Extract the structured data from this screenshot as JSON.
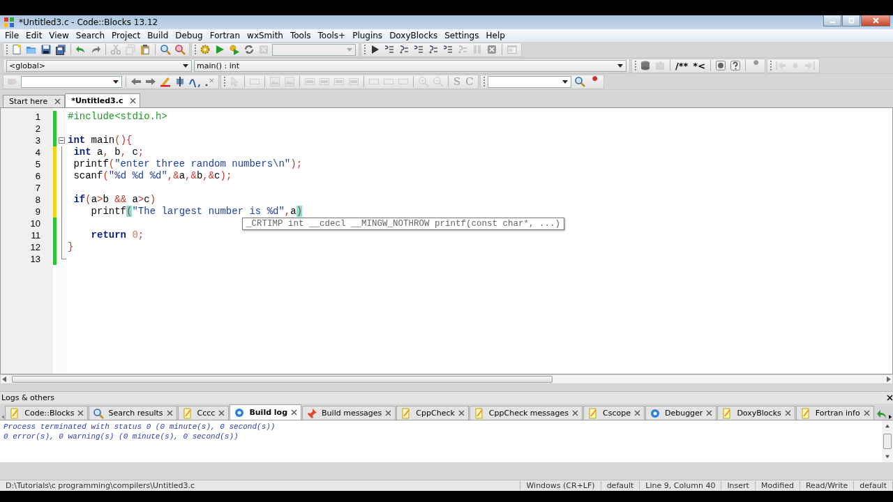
{
  "window": {
    "title": "*Untitled3.c - Code::Blocks 13.12"
  },
  "menu": [
    "File",
    "Edit",
    "View",
    "Search",
    "Project",
    "Build",
    "Debug",
    "Fortran",
    "wxSmith",
    "Tools",
    "Tools+",
    "Plugins",
    "DoxyBlocks",
    "Settings",
    "Help"
  ],
  "main_toolbar": [
    {
      "disabled": false
    },
    {
      "disabled": false
    },
    {
      "disabled": false
    },
    {
      "disabled": false
    },
    {
      "disabled": false
    },
    {
      "disabled": false
    },
    {
      "disabled": true
    },
    {
      "disabled": true
    },
    {
      "disabled": false
    },
    {
      "disabled": false
    },
    {
      "disabled": false
    },
    {
      "disabled": false
    },
    {
      "disabled": false
    },
    {
      "disabled": false
    },
    {
      "disabled": false
    },
    {
      "disabled": true
    },
    {
      "disabled": false
    },
    {
      "disabled": false
    },
    {
      "disabled": false
    },
    {
      "disabled": false
    },
    {
      "disabled": false
    },
    {
      "disabled": false
    },
    {
      "disabled": true
    },
    {
      "disabled": true
    },
    {
      "disabled": false
    },
    {
      "disabled": true
    }
  ],
  "code_completion": {
    "scope": "<global>",
    "function": "main() : int"
  },
  "doxyblocks_buttons": [
    "/**",
    "*<"
  ],
  "search_toolbar_buttons": [
    "S",
    "C"
  ],
  "editor_tabs": [
    {
      "label": "Start here",
      "selected": false
    },
    {
      "label": "*Untitled3.c",
      "selected": true
    }
  ],
  "code": [
    {
      "number": "1",
      "modified": false,
      "tokens": [
        {
          "t": "#include<stdio.h>",
          "kind": "preprocessor"
        }
      ]
    },
    {
      "number": "2",
      "modified": false
    },
    {
      "number": "3",
      "modified": false,
      "expanded": true,
      "tokens": [
        {
          "t": "int",
          "kind": "keyword"
        },
        {
          "t": " main",
          "kind": "identifier"
        },
        {
          "t": "(){",
          "kind": "operator"
        }
      ]
    },
    {
      "number": "4",
      "modified": true,
      "tokens": [
        {
          "t": " int",
          "kind": "keyword"
        },
        {
          "t": " a",
          "kind": "identifier"
        },
        {
          "t": ",",
          "kind": "operator"
        },
        {
          "t": " b",
          "kind": "identifier"
        },
        {
          "t": ",",
          "kind": "operator"
        },
        {
          "t": " c",
          "kind": "identifier"
        },
        {
          "t": ";",
          "kind": "operator"
        }
      ]
    },
    {
      "number": "5",
      "modified": true,
      "tokens": [
        {
          "t": " printf",
          "kind": "identifier"
        },
        {
          "t": "(",
          "kind": "operator"
        },
        {
          "t": "\"enter three random numbers\\n\"",
          "kind": "string"
        },
        {
          "t": ");",
          "kind": "operator"
        }
      ]
    },
    {
      "number": "6",
      "modified": true,
      "tokens": [
        {
          "t": " scanf",
          "kind": "identifier"
        },
        {
          "t": "(",
          "kind": "operator"
        },
        {
          "t": "\"%d %d %d\"",
          "kind": "string"
        },
        {
          "t": ",&",
          "kind": "operator"
        },
        {
          "t": "a",
          "kind": "identifier"
        },
        {
          "t": ",&",
          "kind": "operator"
        },
        {
          "t": "b",
          "kind": "identifier"
        },
        {
          "t": ",&",
          "kind": "operator"
        },
        {
          "t": "c",
          "kind": "identifier"
        },
        {
          "t": ");",
          "kind": "operator"
        }
      ]
    },
    {
      "number": "7",
      "modified": true
    },
    {
      "number": "8",
      "modified": true,
      "tokens": [
        {
          "t": " if",
          "kind": "keyword"
        },
        {
          "t": "(",
          "kind": "operator"
        },
        {
          "t": "a",
          "kind": "identifier"
        },
        {
          "t": ">",
          "kind": "operator"
        },
        {
          "t": "b ",
          "kind": "identifier"
        },
        {
          "t": "&&",
          "kind": "operator"
        },
        {
          "t": " a",
          "kind": "identifier"
        },
        {
          "t": ">",
          "kind": "operator"
        },
        {
          "t": "c",
          "kind": "identifier"
        },
        {
          "t": ")",
          "kind": "operator"
        }
      ]
    },
    {
      "number": "9",
      "modified": true,
      "tokens": [
        {
          "t": "    printf",
          "kind": "identifier"
        },
        {
          "t": "(",
          "kind": "brace"
        },
        {
          "t": "\"The largest number is %d\"",
          "kind": "string"
        },
        {
          "t": ",",
          "kind": "operator"
        },
        {
          "t": "a",
          "kind": "identifier"
        },
        {
          "t": ")",
          "kind": "brace"
        }
      ]
    },
    {
      "number": "10",
      "modified": false
    },
    {
      "number": "11",
      "modified": false,
      "tokens": [
        {
          "t": "    return",
          "kind": "keyword"
        },
        {
          "t": " 0",
          "kind": "number"
        },
        {
          "t": ";",
          "kind": "operator"
        }
      ]
    },
    {
      "number": "12",
      "modified": false,
      "tokens": [
        {
          "t": "}",
          "kind": "operator"
        }
      ]
    },
    {
      "number": "13",
      "modified": false
    }
  ],
  "calltip": "_CRTIMP int __cdecl __MINGW_NOTHROW printf(const char*, ...)",
  "logs": {
    "title": "Logs & others",
    "tabs": [
      {
        "label": "Code::Blocks",
        "selected": false
      },
      {
        "label": "Search results",
        "selected": false
      },
      {
        "label": "Cccc",
        "selected": false
      },
      {
        "label": "Build log",
        "selected": true
      },
      {
        "label": "Build messages",
        "selected": false
      },
      {
        "label": "CppCheck",
        "selected": false
      },
      {
        "label": "CppCheck messages",
        "selected": false
      },
      {
        "label": "Cscope",
        "selected": false
      },
      {
        "label": "Debugger",
        "selected": false
      },
      {
        "label": "DoxyBlocks",
        "selected": false
      },
      {
        "label": "Fortran info",
        "selected": false
      }
    ],
    "lines": [
      "Process terminated with status 0 (0 minute(s), 0 second(s))",
      "0 error(s), 0 warning(s) (0 minute(s), 0 second(s))"
    ]
  },
  "status_bar": [
    "D:\\Tutorials\\c programming\\compilers\\Untitled3.c",
    "Windows (CR+LF)",
    "default",
    "Line 9, Column 40",
    "Insert",
    "Modified",
    "Read/Write",
    "default"
  ]
}
